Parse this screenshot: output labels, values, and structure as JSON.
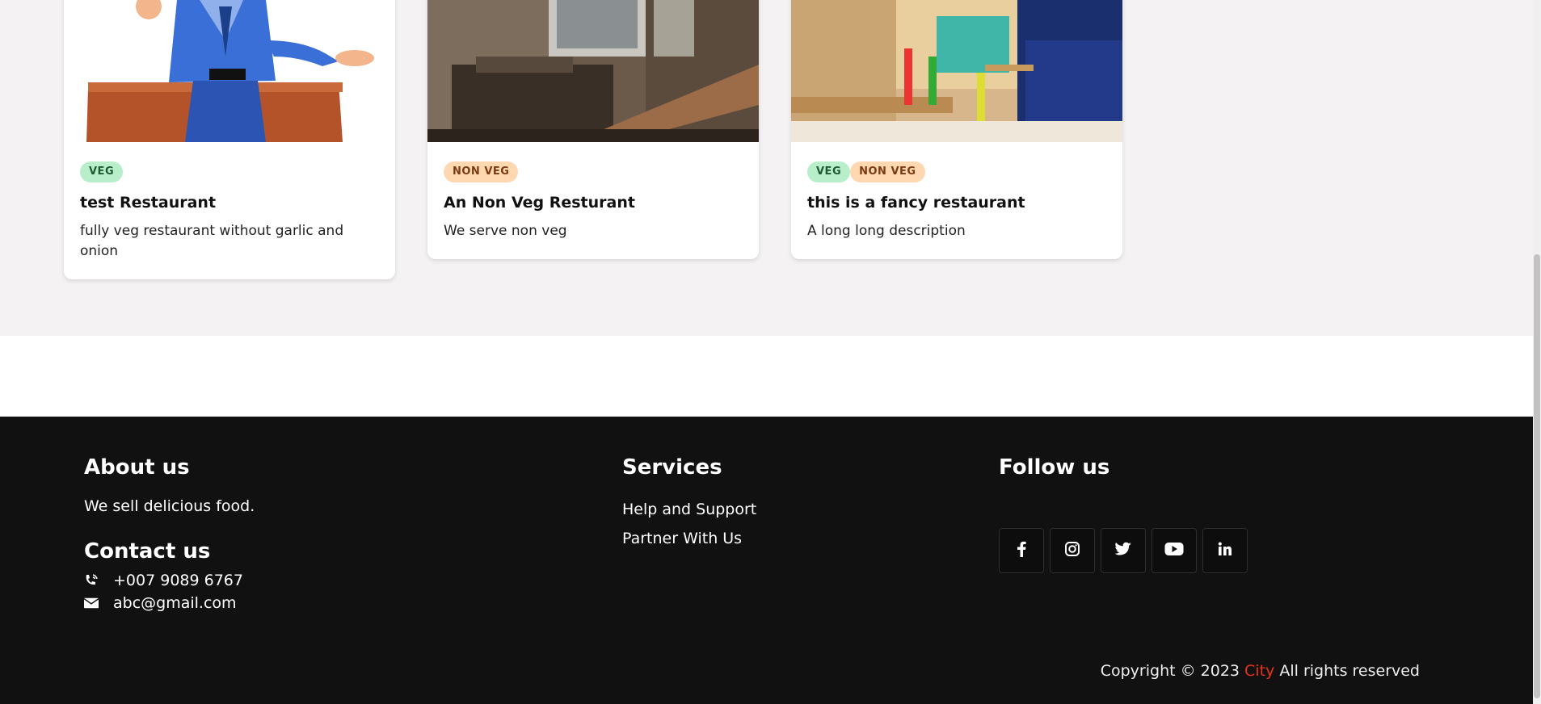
{
  "cards": [
    {
      "tags": [
        {
          "label": "VEG",
          "kind": "veg"
        }
      ],
      "title": "test Restaurant",
      "description": "fully veg restaurant without garlic and onion"
    },
    {
      "tags": [
        {
          "label": "NON VEG",
          "kind": "nonveg"
        }
      ],
      "title": "An Non Veg Resturant",
      "description": "We serve non veg"
    },
    {
      "tags": [
        {
          "label": "VEG",
          "kind": "veg"
        },
        {
          "label": "NON VEG",
          "kind": "nonveg"
        }
      ],
      "title": "this is a fancy restaurant",
      "description": "A long long description"
    }
  ],
  "footer": {
    "about": {
      "heading": "About us",
      "text": "We sell delicious food."
    },
    "contact": {
      "heading": "Contact us",
      "phone": "+007 9089 6767",
      "email": "abc@gmail.com"
    },
    "services": {
      "heading": "Services",
      "links": [
        "Help and Support",
        "Partner With Us"
      ]
    },
    "follow": {
      "heading": "Follow us",
      "icons": [
        "facebook-icon",
        "instagram-icon",
        "twitter-icon",
        "youtube-icon",
        "linkedin-icon"
      ]
    },
    "copyright": {
      "prefix": "Copyright © 2023",
      "brand": "City",
      "suffix": "All rights reserved"
    }
  },
  "colors": {
    "brand": "#e8321e",
    "footer_bg": "#111111",
    "veg_tag": "#b9eecb",
    "nonveg_tag": "#ffd7b0"
  }
}
